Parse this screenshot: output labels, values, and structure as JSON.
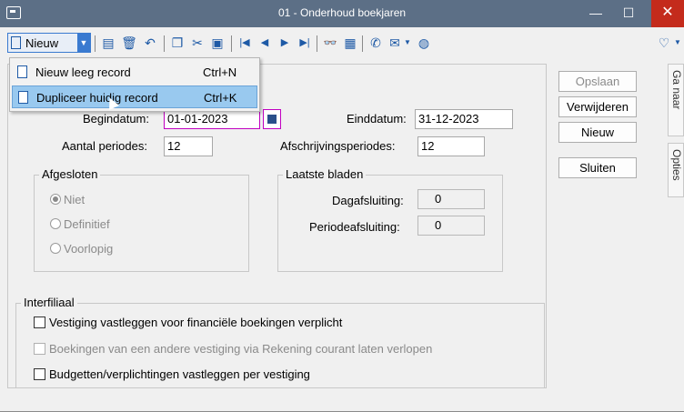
{
  "window": {
    "title": "01 - Onderhoud boekjaren",
    "minimize": "—",
    "maximize": "☐",
    "close": "✕"
  },
  "toolbar": {
    "nieuw_label": "Nieuw",
    "icons": [
      "save-icon",
      "delete-icon",
      "undo-icon",
      "copy-icon",
      "cut-icon",
      "paste-icon",
      "first-icon",
      "prev-icon",
      "next-icon",
      "last-icon",
      "binoculars-icon",
      "grid-icon",
      "phone-icon",
      "mail-icon",
      "globe-icon",
      "heart-icon"
    ]
  },
  "menu": {
    "items": [
      {
        "label": "Nieuw leeg record",
        "shortcut": "Ctrl+N"
      },
      {
        "label": "Dupliceer huidig record",
        "shortcut": "Ctrl+K"
      }
    ]
  },
  "form": {
    "begindatum_label": "Begindatum:",
    "begindatum_value": "01-01-2023",
    "einddatum_label": "Einddatum:",
    "einddatum_value": "31-12-2023",
    "aantal_label": "Aantal periodes:",
    "aantal_value": "12",
    "afschrijving_label": "Afschrijvingsperiodes:",
    "afschrijving_value": "12"
  },
  "afgesloten": {
    "title": "Afgesloten",
    "options": [
      "Niet",
      "Definitief",
      "Voorlopig"
    ],
    "selected": "Niet"
  },
  "laatste_bladen": {
    "title": "Laatste bladen",
    "dag_label": "Dagafsluiting:",
    "dag_value": "0",
    "periode_label": "Periodeafsluiting:",
    "periode_value": "0"
  },
  "interfiliaal": {
    "title": "Interfiliaal",
    "checks": [
      {
        "label": "Vestiging vastleggen voor financiële boekingen verplicht",
        "checked": false,
        "disabled": false
      },
      {
        "label": "Boekingen van een andere vestiging via Rekening courant laten verlopen",
        "checked": false,
        "disabled": true
      },
      {
        "label": "Budgetten/verplichtingen vastleggen per vestiging",
        "checked": false,
        "disabled": false
      }
    ]
  },
  "side_buttons": {
    "opslaan": "Opslaan",
    "verwijderen": "Verwijderen",
    "nieuw": "Nieuw",
    "sluiten": "Sluiten"
  },
  "side_tabs": {
    "ga_naar": "Ga naar",
    "opties": "Opties"
  },
  "colors": {
    "titlebar": "#5c6f86",
    "close": "#c42b1c",
    "accent": "#1e5aa6",
    "highlight": "#99c9ef",
    "focus": "#c000c0"
  }
}
